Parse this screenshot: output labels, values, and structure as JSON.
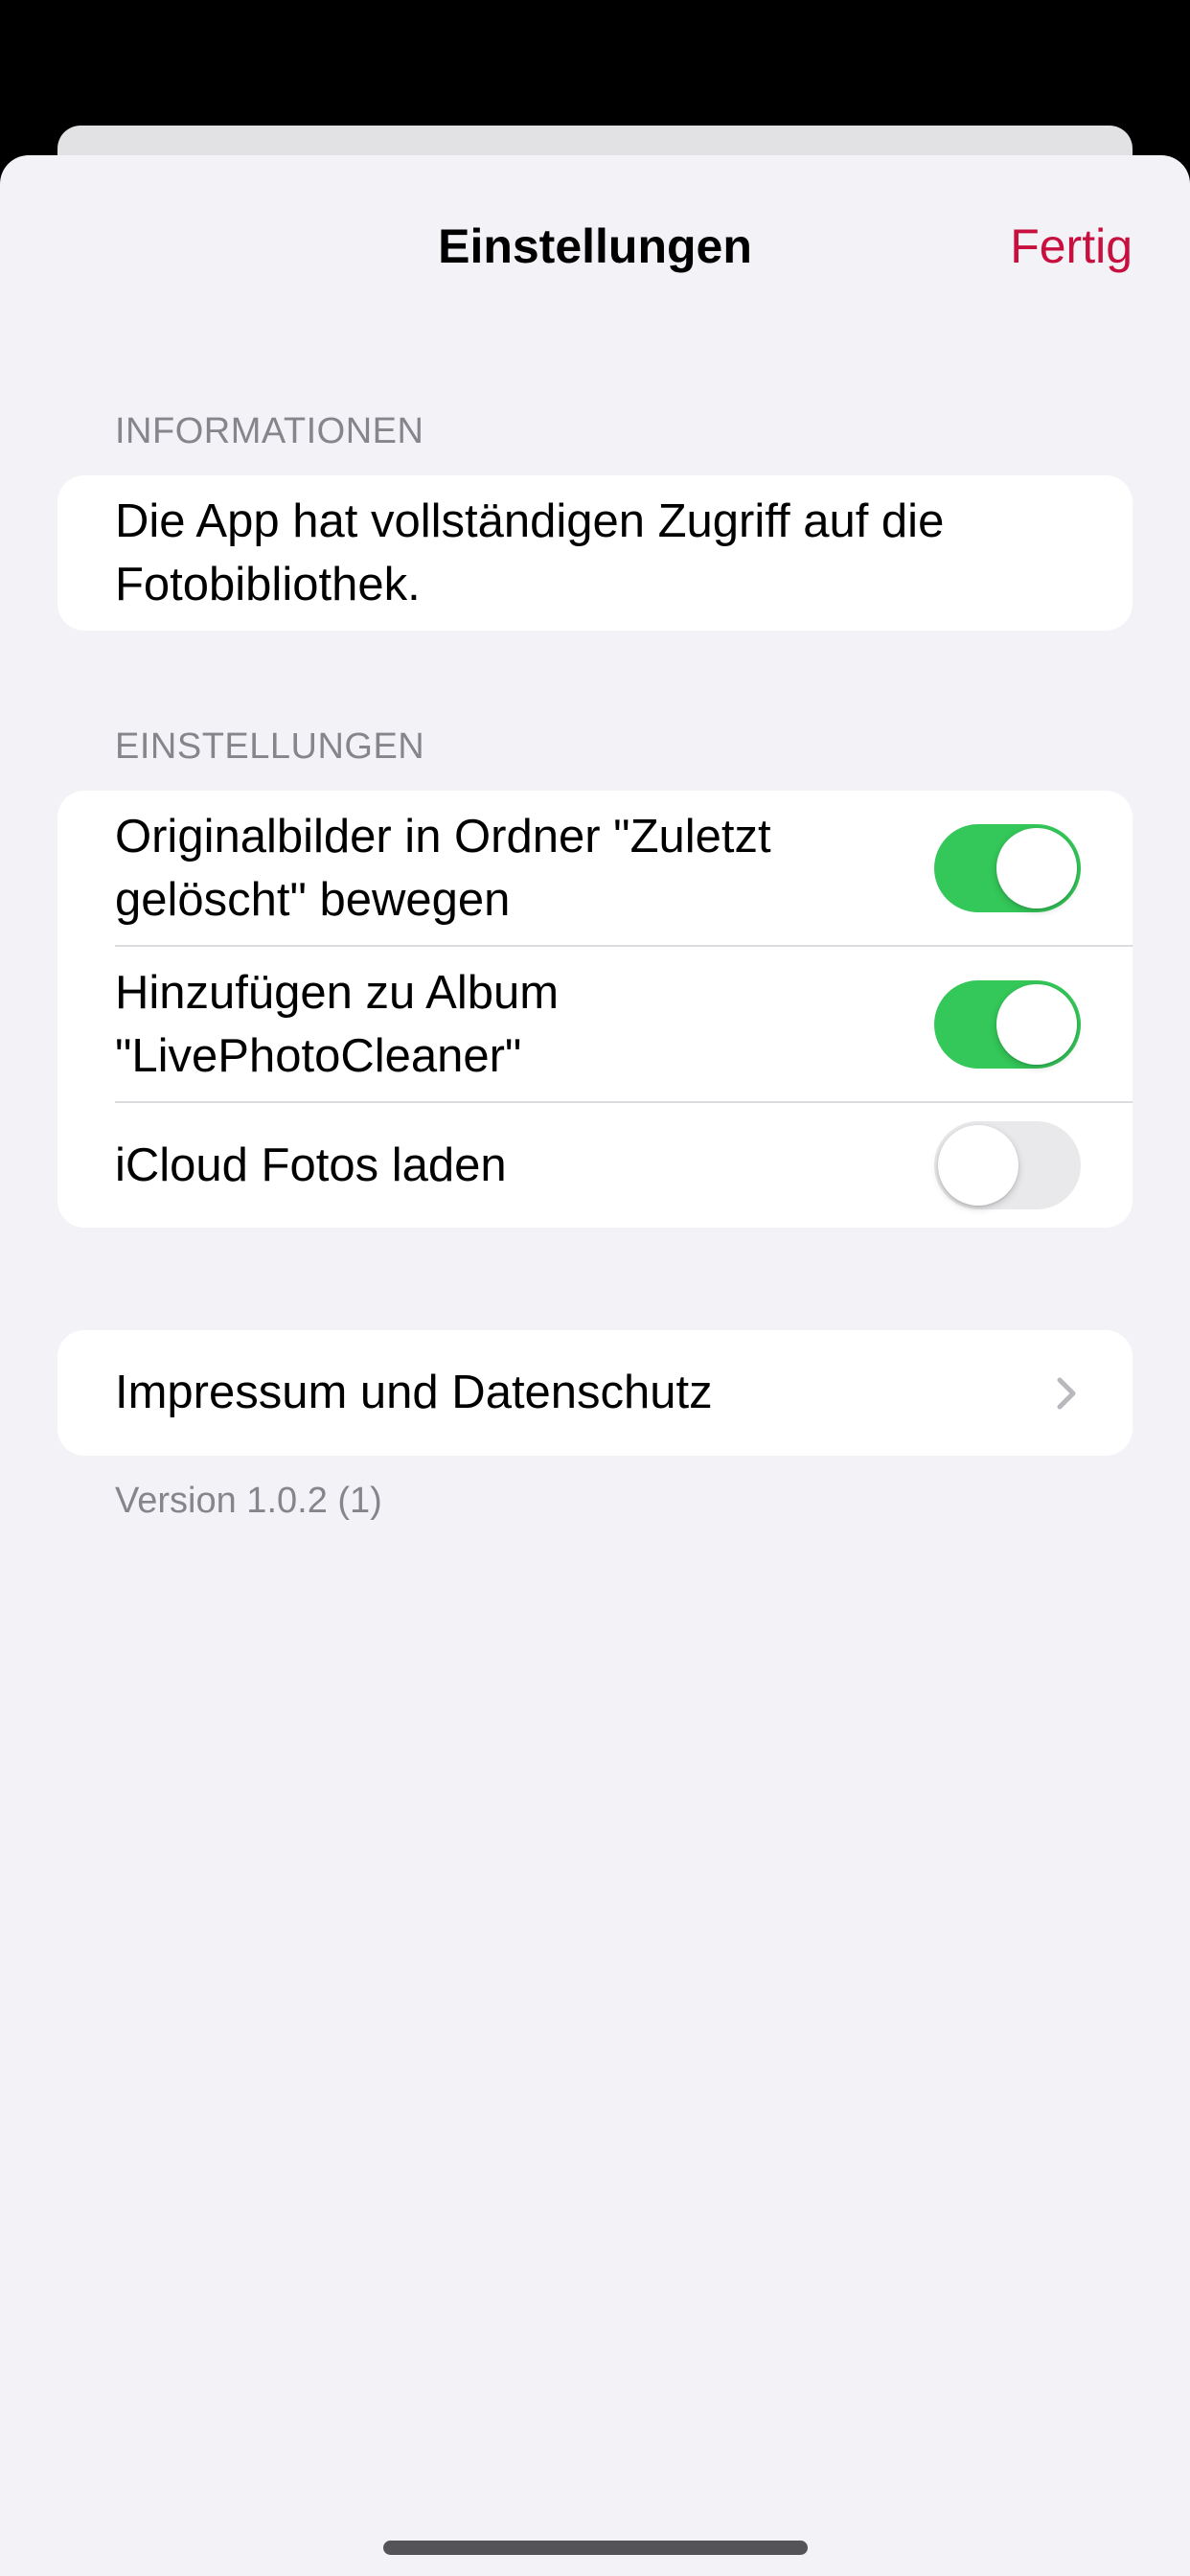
{
  "nav": {
    "title": "Einstellungen",
    "done_label": "Fertig"
  },
  "sections": {
    "info": {
      "header": "INFORMATIONEN",
      "text": "Die App hat vollständigen Zugriff auf die Fotobibliothek."
    },
    "settings": {
      "header": "EINSTELLUNGEN",
      "rows": [
        {
          "label": "Originalbilder in Ordner \"Zuletzt gelöscht\" bewegen",
          "toggle": "on"
        },
        {
          "label": "Hinzufügen zu Album \"LivePhotoCleaner\"",
          "toggle": "on"
        },
        {
          "label": "iCloud Fotos laden",
          "toggle": "off"
        }
      ]
    },
    "legal": {
      "row_label": "Impressum und Datenschutz",
      "icon": "chevron-right-icon",
      "footer": "Version 1.0.2 (1)"
    }
  },
  "colors": {
    "accent": "#c8103f",
    "toggle_on": "#34c759",
    "toggle_off": "#e9e9eb",
    "background": "#f2f2f7"
  }
}
